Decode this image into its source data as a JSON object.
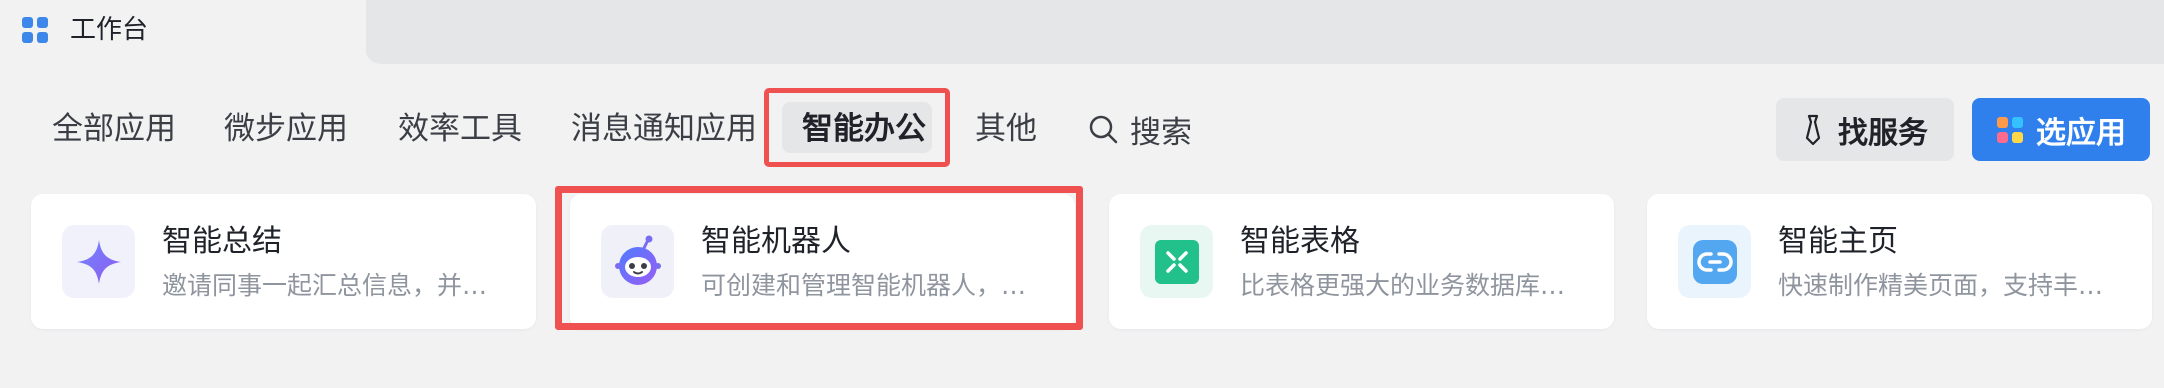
{
  "topbar": {
    "tab_title": "工作台",
    "tab_icon": "grid-icon"
  },
  "nav": {
    "items": [
      "全部应用",
      "微步应用",
      "效率工具",
      "消息通知应用",
      "智能办公",
      "其他"
    ],
    "active": "智能办公",
    "search_label": "搜索"
  },
  "actions": {
    "find_service_label": "找服务",
    "choose_app_label": "选应用"
  },
  "cards": [
    {
      "title": "智能总结",
      "desc": "邀请同事一起汇总信息，并…",
      "icon": "sparkle-icon",
      "icon_bg": "#f1f1fb"
    },
    {
      "title": "智能机器人",
      "desc": "可创建和管理智能机器人，…",
      "icon": "robot-icon",
      "icon_bg": "#f0f0f8"
    },
    {
      "title": "智能表格",
      "desc": "比表格更强大的业务数据库…",
      "icon": "table-icon",
      "icon_bg": "#e9f7f2"
    },
    {
      "title": "智能主页",
      "desc": "快速制作精美页面，支持丰…",
      "icon": "link-icon",
      "icon_bg": "#eaf4fd"
    }
  ],
  "colors": {
    "accent_blue": "#2f80ed",
    "highlight_red": "#ef5151",
    "page_bg": "#f2f2f3"
  }
}
